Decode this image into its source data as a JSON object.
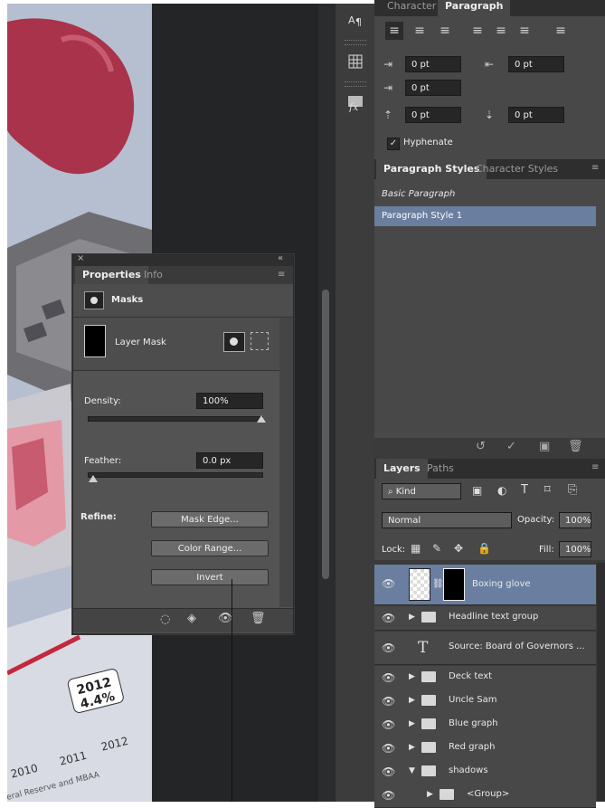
{
  "artwork": {
    "years": [
      "2010",
      "2011",
      "2012"
    ],
    "badge_year": "2012",
    "badge_value": "4.4%",
    "source_text": "eral Reserve and MBAA"
  },
  "toolstrip": {
    "icons": [
      "character-paragraph-icon",
      "grid-icon",
      "fx-icon"
    ]
  },
  "paragraph_panel": {
    "tabs": [
      "Character",
      "Paragraph"
    ],
    "indent_left": "0 pt",
    "indent_right": "0 pt",
    "indent_first": "0 pt",
    "space_before": "0 pt",
    "space_after": "0 pt",
    "hyphenate_label": "Hyphenate"
  },
  "styles_panel": {
    "tabs": [
      "Paragraph Styles",
      "Character Styles"
    ],
    "items": [
      "Basic Paragraph",
      "Paragraph Style 1"
    ]
  },
  "layers_panel": {
    "tabs": [
      "Layers",
      "Paths"
    ],
    "filter": "Kind",
    "blend_mode": "Normal",
    "opacity_label": "Opacity:",
    "opacity": "100%",
    "lock_label": "Lock:",
    "fill_label": "Fill:",
    "fill": "100%",
    "layers": [
      {
        "name": "Boxing glove",
        "type": "masked"
      },
      {
        "name": "Headline text group",
        "type": "group"
      },
      {
        "name": "Source: Board of Governors ...",
        "type": "text"
      },
      {
        "name": "Deck text",
        "type": "group"
      },
      {
        "name": "Uncle Sam",
        "type": "group"
      },
      {
        "name": "Blue graph",
        "type": "group"
      },
      {
        "name": "Red graph",
        "type": "group"
      },
      {
        "name": "shadows",
        "type": "group-open"
      },
      {
        "name": "<Group>",
        "type": "group"
      }
    ]
  },
  "properties_panel": {
    "tabs": [
      "Properties",
      "Info"
    ],
    "section_title": "Masks",
    "mask_label": "Layer Mask",
    "density_label": "Density:",
    "density": "100%",
    "density_level": 1.0,
    "feather_label": "Feather:",
    "feather": "0.0 px",
    "feather_level": 0.0,
    "refine_label": "Refine:",
    "mask_edge_button": "Mask Edge...",
    "color_range_button": "Color Range...",
    "invert_button": "Invert"
  },
  "colors": {
    "selected_row": "#6a7f9f",
    "panel_bg": "#3b3b3b",
    "glove_red": "#a8334a"
  }
}
